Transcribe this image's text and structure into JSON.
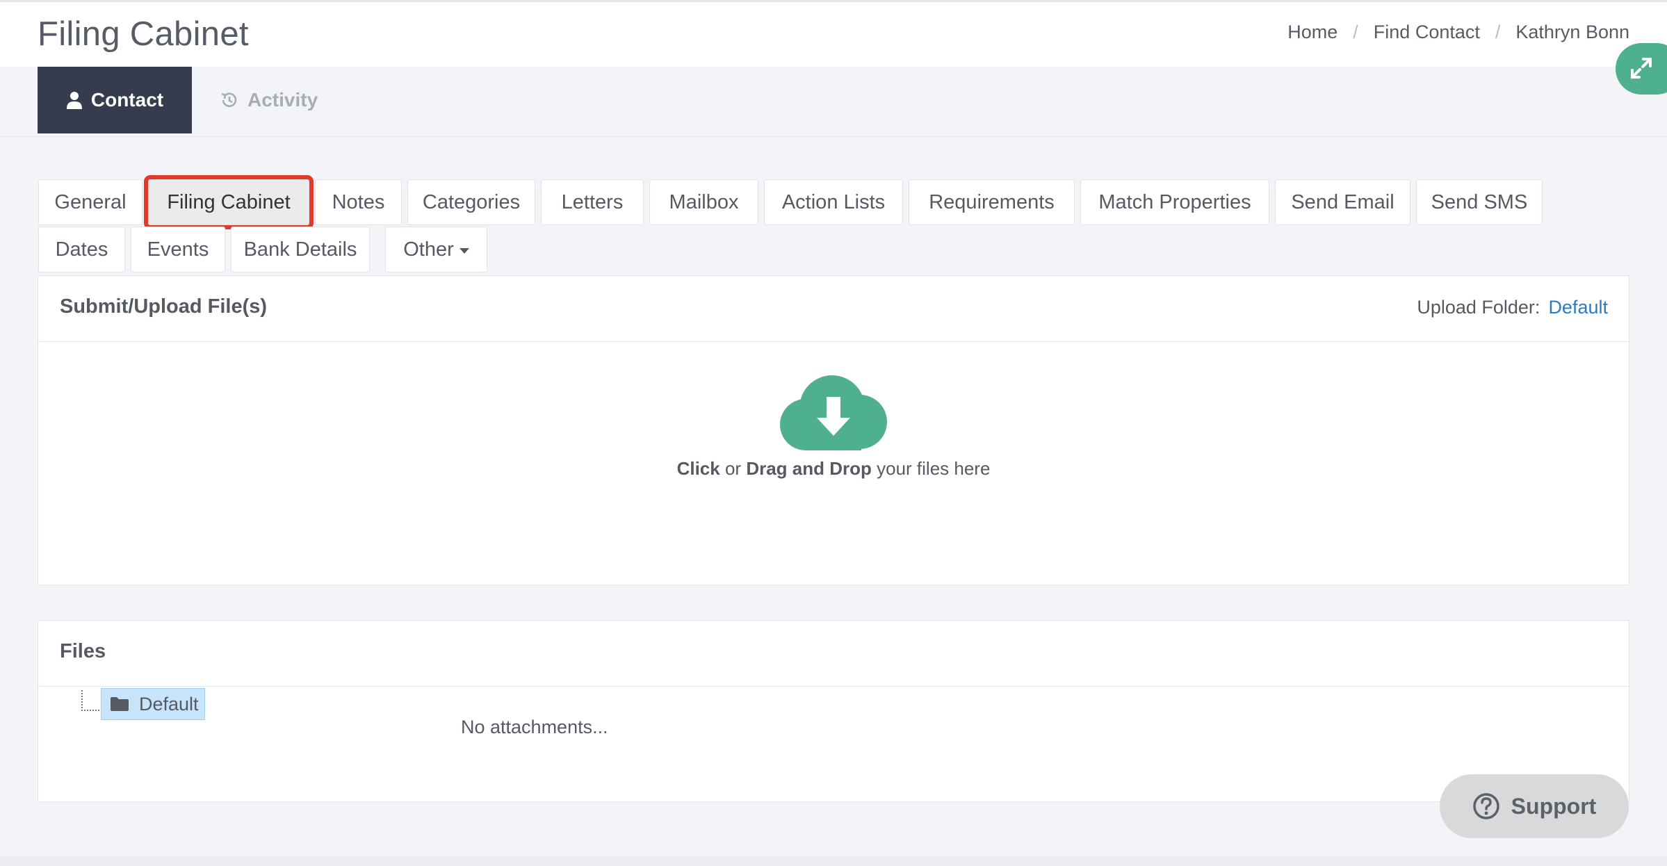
{
  "header": {
    "title": "Filing Cabinet",
    "breadcrumb": [
      "Home",
      "Find Contact",
      "Kathryn Bonn"
    ],
    "breadcrumb_separator": "/"
  },
  "main_nav": {
    "tabs": [
      {
        "label": "Contact",
        "icon": "user-icon",
        "active": true
      },
      {
        "label": "Activity",
        "icon": "history-icon",
        "active": false
      }
    ]
  },
  "sub_tabs": {
    "row1": [
      "General",
      "Filing Cabinet",
      "Notes",
      "Categories",
      "Letters",
      "Mailbox",
      "Action Lists",
      "Requirements",
      "Match Properties",
      "Send Email",
      "Send SMS"
    ],
    "row2": [
      "Dates",
      "Events",
      "Bank Details",
      "Other"
    ],
    "selected": "Filing Cabinet"
  },
  "upload_panel": {
    "title": "Submit/Upload File(s)",
    "folder_label": "Upload Folder:",
    "folder_value": "Default",
    "drop_click": "Click",
    "drop_or": " or ",
    "drop_drag": "Drag and Drop",
    "drop_rest": " your files here",
    "icon": "cloud-download-icon"
  },
  "files_panel": {
    "title": "Files",
    "tree_root": "Default",
    "empty_text": "No attachments..."
  },
  "support": {
    "label": "Support",
    "icon": "question-circle-icon"
  },
  "colors": {
    "accent_green": "#4eb08f",
    "nav_active_bg": "#353c4e",
    "highlight_red": "#e23a2a",
    "link_blue": "#2d7bbf"
  }
}
